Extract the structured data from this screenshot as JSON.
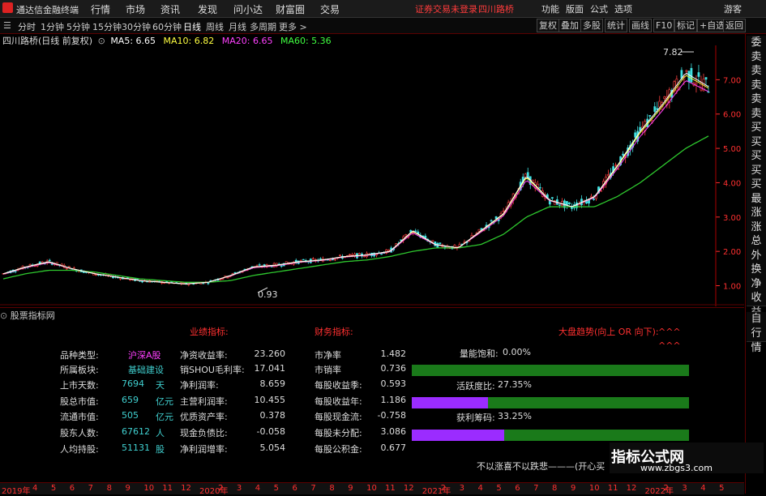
{
  "app": {
    "title": "通达信金融终端"
  },
  "menu": {
    "items": [
      "行情",
      "市场",
      "资讯",
      "发现",
      "问小达",
      "财富圈",
      "交易"
    ],
    "notice": "证券交易未登录",
    "stock_name": "四川路桥",
    "right_items": [
      "功能",
      "版面",
      "公式",
      "选项"
    ],
    "guest": "游客"
  },
  "periods": [
    "分时",
    "1分钟",
    "5分钟",
    "15分钟",
    "30分钟",
    "60分钟",
    "日线",
    "周线",
    "月线",
    "多周期",
    "更多 >"
  ],
  "right_buttons": [
    "复权",
    "叠加",
    "多股",
    "统计",
    "画线",
    "F10",
    "标记",
    "+自选",
    "返回"
  ],
  "chart": {
    "header_title": "四川路桥(日线 前复权)",
    "ma": [
      {
        "label": "MA5: 6.65",
        "color": "#ffffff"
      },
      {
        "label": "MA10: 6.82",
        "color": "#ffff40"
      },
      {
        "label": "MA20: 6.65",
        "color": "#ff40ff"
      },
      {
        "label": "MA60: 5.36",
        "color": "#40ff40"
      }
    ],
    "high_label": "7.82",
    "low_label": "0.93",
    "y_ticks": [
      "7.00",
      "6.00",
      "5.00",
      "4.00",
      "3.00",
      "2.00",
      "1.00"
    ]
  },
  "chart_data": {
    "type": "line",
    "title": "四川路桥(日线 前复权)",
    "ylim": [
      0.8,
      8.0
    ],
    "y_ticks": [
      1.0,
      2.0,
      3.0,
      4.0,
      5.0,
      6.0,
      7.0
    ],
    "series": [
      {
        "name": "MA5",
        "values": [
          1.35,
          1.55,
          1.7,
          1.5,
          1.35,
          1.25,
          1.15,
          1.1,
          1.05,
          1.1,
          1.3,
          1.55,
          1.6,
          1.7,
          1.75,
          1.85,
          1.9,
          2.0,
          2.6,
          2.2,
          2.1,
          2.6,
          3.1,
          4.2,
          3.5,
          3.3,
          3.6,
          4.5,
          5.5,
          6.3,
          7.2,
          6.8
        ]
      },
      {
        "name": "MA60",
        "values": [
          1.2,
          1.35,
          1.45,
          1.45,
          1.4,
          1.3,
          1.2,
          1.15,
          1.1,
          1.1,
          1.15,
          1.3,
          1.4,
          1.5,
          1.6,
          1.7,
          1.75,
          1.85,
          2.0,
          2.1,
          2.1,
          2.2,
          2.5,
          3.0,
          3.3,
          3.3,
          3.3,
          3.6,
          4.0,
          4.5,
          5.0,
          5.36
        ]
      }
    ]
  },
  "side": [
    "委比",
    "卖五",
    "卖四",
    "卖三",
    "卖二",
    "卖一",
    "买一",
    "买二",
    "买三",
    "买四",
    "买五",
    "最新",
    "涨跌",
    "涨幅",
    "总量",
    "外盘",
    "换手",
    "净资",
    "收益"
  ],
  "side_bottom": [
    "自动",
    "行情"
  ],
  "panel": {
    "title": "股票指标网",
    "perf_header": "业绩指标:",
    "fin_header": "财务指标:",
    "trend_header": "大盘趋势(向上 OR 向下):",
    "trend_value1": "^^^",
    "trend_value2": "^^^",
    "left": [
      {
        "label": "品种类型:",
        "value": "沪深A股",
        "unit": ""
      },
      {
        "label": "所属板块:",
        "value": "基础建设",
        "unit": ""
      },
      {
        "label": "上市天数:",
        "value": "7694",
        "unit": "天"
      },
      {
        "label": "股总市值:",
        "value": "659",
        "unit": "亿元"
      },
      {
        "label": "流通市值:",
        "value": "505",
        "unit": "亿元"
      },
      {
        "label": "股东人数:",
        "value": "67612",
        "unit": "人"
      },
      {
        "label": "人均持股:",
        "value": "51131",
        "unit": "股"
      }
    ],
    "perf": [
      {
        "label": "净资收益率:",
        "value": "23.260"
      },
      {
        "label": "销SHOU毛利率:",
        "value": "17.041"
      },
      {
        "label": "净利润率:",
        "value": "8.659"
      },
      {
        "label": "主营利润率:",
        "value": "10.455"
      },
      {
        "label": "优质资产率:",
        "value": "0.378"
      },
      {
        "label": "现金负债比:",
        "value": "-0.058"
      },
      {
        "label": "净利润增率:",
        "value": "5.054"
      }
    ],
    "fin": [
      {
        "label": "市净率",
        "value": "1.482"
      },
      {
        "label": "市销率",
        "value": "0.736"
      },
      {
        "label": "每股收益季:",
        "value": "0.593"
      },
      {
        "label": "每股收益年:",
        "value": "1.186"
      },
      {
        "label": "每股现金流:",
        "value": "-0.758"
      },
      {
        "label": "每股未分配:",
        "value": "3.086"
      },
      {
        "label": "每股公积金:",
        "value": "0.677"
      }
    ],
    "meters": [
      {
        "label": "量能饱和:",
        "value": "0.00%",
        "fill": 0.0
      },
      {
        "label": "活跃度比:",
        "value": "27.35%",
        "fill": 0.2735
      },
      {
        "label": "获利筹码:",
        "value": "33.25%",
        "fill": 0.3325
      }
    ],
    "footer": "不以涨喜不以跌悲———(开心买"
  },
  "timeline": {
    "year": "2019年",
    "marks": [
      "4",
      "5",
      "6",
      "7",
      "8",
      "9",
      "10",
      "11",
      "12",
      "2020年",
      "2",
      "3",
      "4",
      "5",
      "6",
      "7",
      "8",
      "9",
      "10",
      "11",
      "12",
      "2021年",
      "2",
      "3",
      "4",
      "5",
      "6",
      "7",
      "8",
      "9",
      "10",
      "11",
      "12",
      "2022年",
      "2",
      "3",
      "4",
      "5"
    ]
  },
  "watermark": {
    "text": "指标公式网",
    "url": "www.zbgs3.com"
  }
}
